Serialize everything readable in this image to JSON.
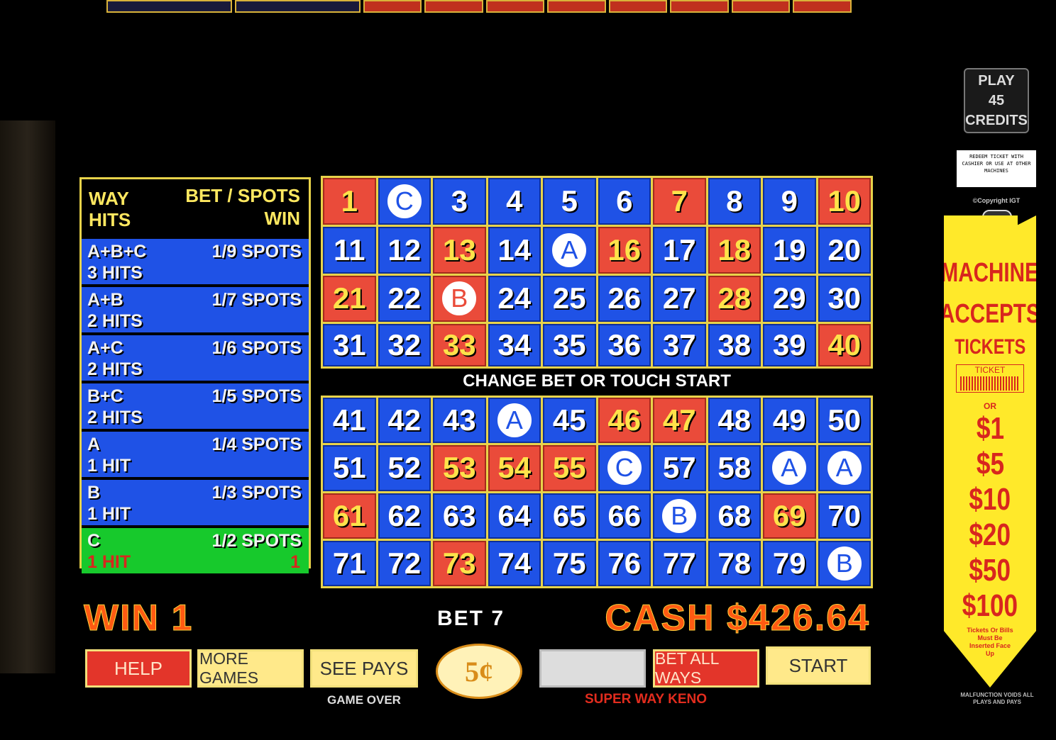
{
  "way_table": {
    "header": {
      "left_line1": "WAY",
      "left_line2": "HITS",
      "right_line1": "BET / SPOTS",
      "right_line2": "WIN"
    },
    "rows": [
      {
        "combo": "A+B+C",
        "hits": "3 HITS",
        "spots": "1/9 SPOTS",
        "win": "",
        "active": false
      },
      {
        "combo": "A+B",
        "hits": "2 HITS",
        "spots": "1/7 SPOTS",
        "win": "",
        "active": false
      },
      {
        "combo": "A+C",
        "hits": "2 HITS",
        "spots": "1/6 SPOTS",
        "win": "",
        "active": false
      },
      {
        "combo": "B+C",
        "hits": "2 HITS",
        "spots": "1/5 SPOTS",
        "win": "",
        "active": false
      },
      {
        "combo": "A",
        "hits": "1 HIT",
        "spots": "1/4 SPOTS",
        "win": "",
        "active": false
      },
      {
        "combo": "B",
        "hits": "1 HIT",
        "spots": "1/3 SPOTS",
        "win": "",
        "active": false
      },
      {
        "combo": "C",
        "hits": "1 HIT",
        "spots": "1/2 SPOTS",
        "win": "1",
        "active": true
      }
    ]
  },
  "board": {
    "drawn": [
      1,
      7,
      10,
      13,
      16,
      18,
      21,
      23,
      28,
      33,
      40,
      46,
      47,
      53,
      54,
      55,
      61,
      69,
      73
    ],
    "marked": {
      "2": "C",
      "15": "A",
      "23": "B",
      "44": "A",
      "56": "C",
      "59": "A",
      "60": "A",
      "67": "B",
      "80": "B"
    },
    "colors": {
      "blue": "#1f52e6",
      "red": "#ea4b3a",
      "frame": "#e8d34a"
    }
  },
  "status_text": "CHANGE BET OR TOUCH START",
  "info": {
    "win": "WIN 1",
    "bet": "BET 7",
    "cash": "CASH $426.64"
  },
  "buttons": {
    "help": "HELP",
    "more_games": "MORE GAMES",
    "see_pays": "SEE PAYS",
    "denomination": "5¢",
    "bet_all_ways": "BET ALL WAYS",
    "start": "START"
  },
  "game_over": "GAME OVER",
  "game_name": "SUPER WAY KENO",
  "side_panel": {
    "play": [
      "PLAY",
      "45",
      "CREDITS"
    ],
    "redeem_note": "REDEEM TICKET WITH CASHIER OR USE AT OTHER MACHINES",
    "copyright": "©Copyright IGT",
    "banner": [
      "MACHINE",
      "ACCEPTS",
      "TICKETS"
    ],
    "ticket_label": "TICKET",
    "or": "OR",
    "amounts": [
      "$1",
      "$5",
      "$10",
      "$20",
      "$50",
      "$100"
    ],
    "note": "Tickets Or Bills Must Be Inserted Face Up",
    "malfunction": "MALFUNCTION VOIDS ALL PLAYS AND PAYS"
  }
}
